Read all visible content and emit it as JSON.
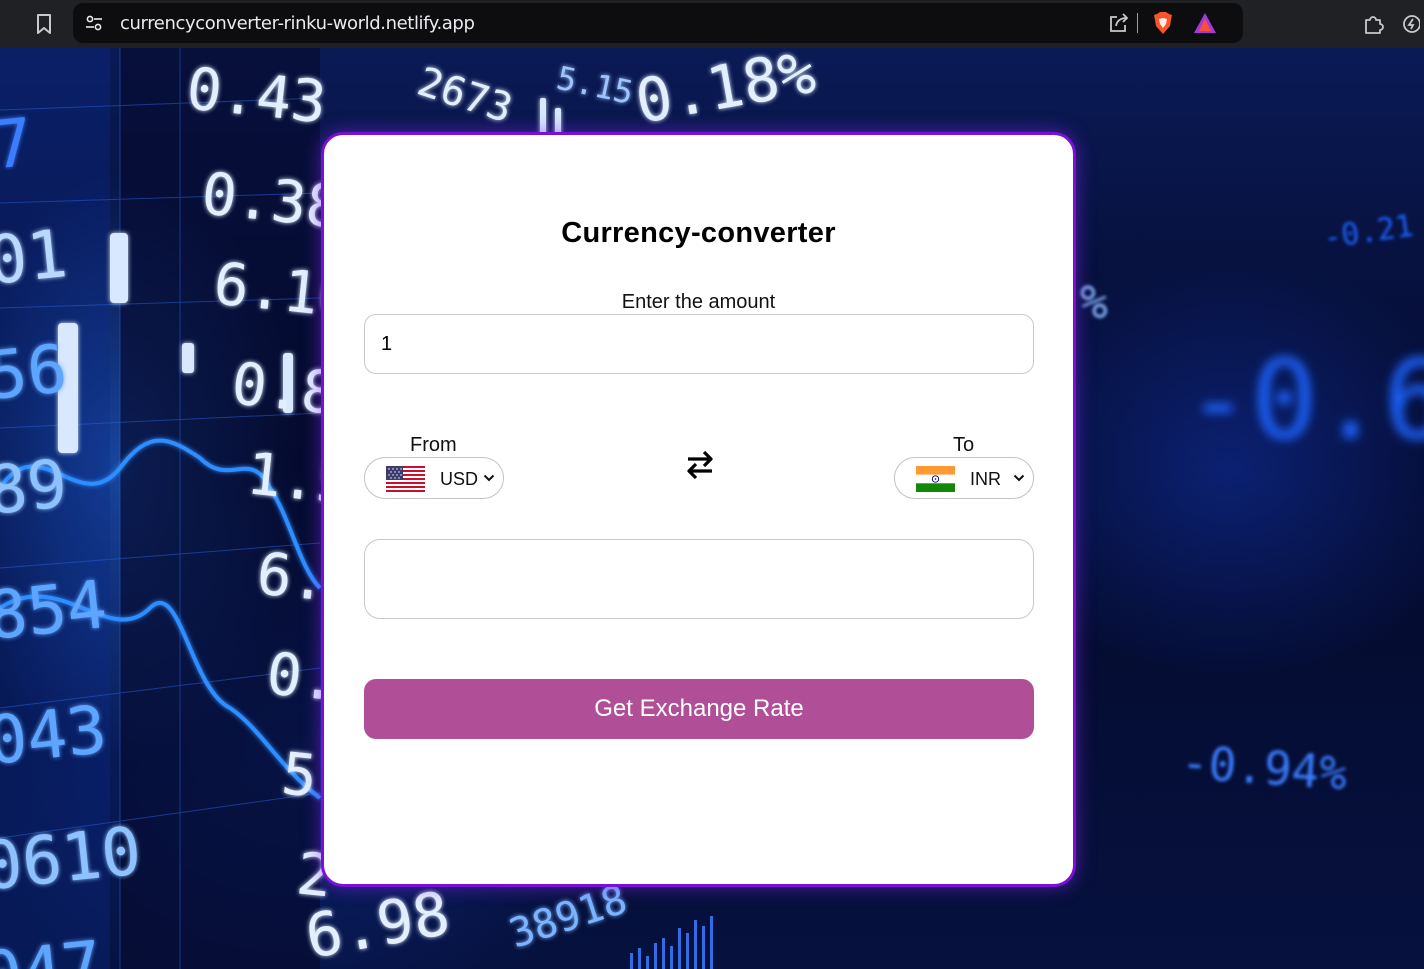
{
  "browser": {
    "url": "currencyconverter-rinku-world.netlify.app",
    "icons": [
      "bookmark-icon",
      "site-settings-icon",
      "share-icon",
      "brave-shields-icon",
      "brave-rewards-icon",
      "extensions-icon",
      "speedreader-icon"
    ]
  },
  "background": {
    "ticker_texts": [
      "0.43",
      "0.38",
      "6.16",
      "0.8",
      "1.5",
      "6.",
      "0.",
      "5",
      "2",
      "7",
      "01",
      "56",
      "89",
      "854",
      "043",
      "0610",
      "047",
      "2673",
      "5.15",
      "0.18%",
      "6.98",
      "38918",
      "-0.21",
      "%",
      "-0.6",
      "-0.94%"
    ]
  },
  "converter": {
    "title": "Currency-converter",
    "amount_label": "Enter the amount",
    "amount_value": "1",
    "from_label": "From",
    "to_label": "To",
    "from_currency": "USD",
    "to_currency": "INR",
    "result_text": "",
    "button_label": "Get Exchange Rate"
  },
  "colors": {
    "button_bg": "#b04f98",
    "card_border": "#7a0fd8",
    "background": "#05081f"
  }
}
